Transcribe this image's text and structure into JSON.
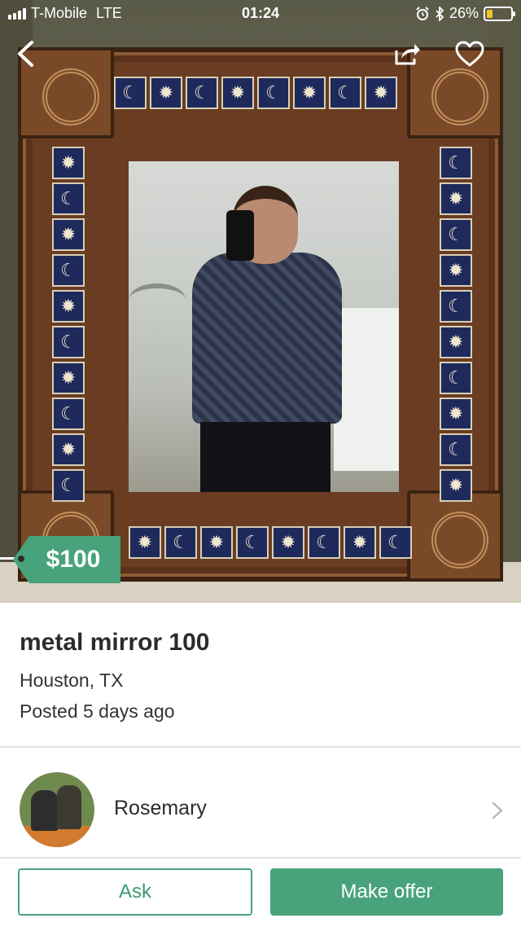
{
  "status_bar": {
    "carrier": "T-Mobile",
    "network": "LTE",
    "time": "01:24",
    "battery_percent_label": "26%",
    "battery_level": 0.26,
    "icons": [
      "signal-bars-icon",
      "alarm-icon",
      "bluetooth-icon",
      "battery-icon"
    ]
  },
  "nav": {
    "back_icon": "chevron-left-icon",
    "share_icon": "share-icon",
    "favorite_icon": "heart-outline-icon"
  },
  "listing": {
    "price": "$100",
    "title": "metal mirror 100",
    "location": "Houston, TX",
    "posted": "Posted 5 days ago"
  },
  "seller": {
    "name": "Rosemary",
    "chevron_icon": "chevron-right-icon"
  },
  "actions": {
    "ask_label": "Ask",
    "offer_label": "Make offer"
  },
  "colors": {
    "accent": "#48a37c",
    "battery": "#f4c531"
  }
}
